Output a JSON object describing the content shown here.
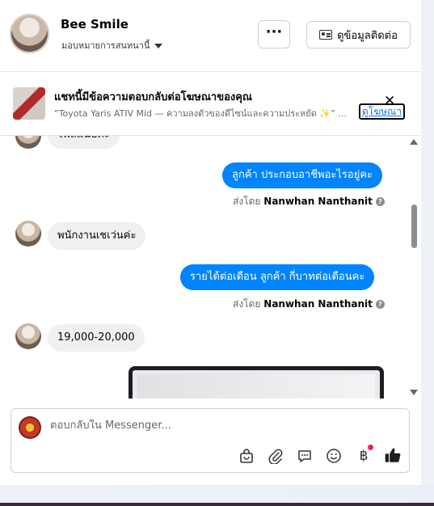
{
  "header": {
    "name": "Bee Smile",
    "subtitle": "มอบหมายการสนทนานี้",
    "more_label": "···",
    "contact_label": "ดูข้อมูลติดต่อ"
  },
  "ad": {
    "title": "แชทนี้มีข้อความตอบกลับต่อโฆษณาของคุณ",
    "description": "“Toyota Yaris ATIV Mid — ความลงตัวของดีไซน์และความประหยัด ✨” ...",
    "link": "ดูโฆษณา",
    "close": "✕"
  },
  "messages": {
    "partial_top": "ไฟล์แนบค่ะ",
    "m1_out": "ลูกค้า ประกอบอาชีพอะไรอยู่คะ",
    "m1_sent_prefix": "ส่งโดย",
    "m1_sender": "Nanwhan Nanthanit",
    "m2_in": "พนักงานเชเว่นค่ะ",
    "m3_out": "รายได้ต่อเดือน  ลูกค้า  กี่บาทต่อเดือนคะ",
    "m3_sent_prefix": "ส่งโดย",
    "m3_sender": "Nanwhan Nanthanit",
    "m4_in": "19,000-20,000",
    "help_glyph": "?"
  },
  "composer": {
    "placeholder": "ตอบกลับใน Messenger...",
    "currency_symbol": "฿"
  },
  "colors": {
    "outgoing_bubble": "#0084ff",
    "incoming_bubble": "#f0f0f0",
    "notification_dot": "#f02849"
  }
}
